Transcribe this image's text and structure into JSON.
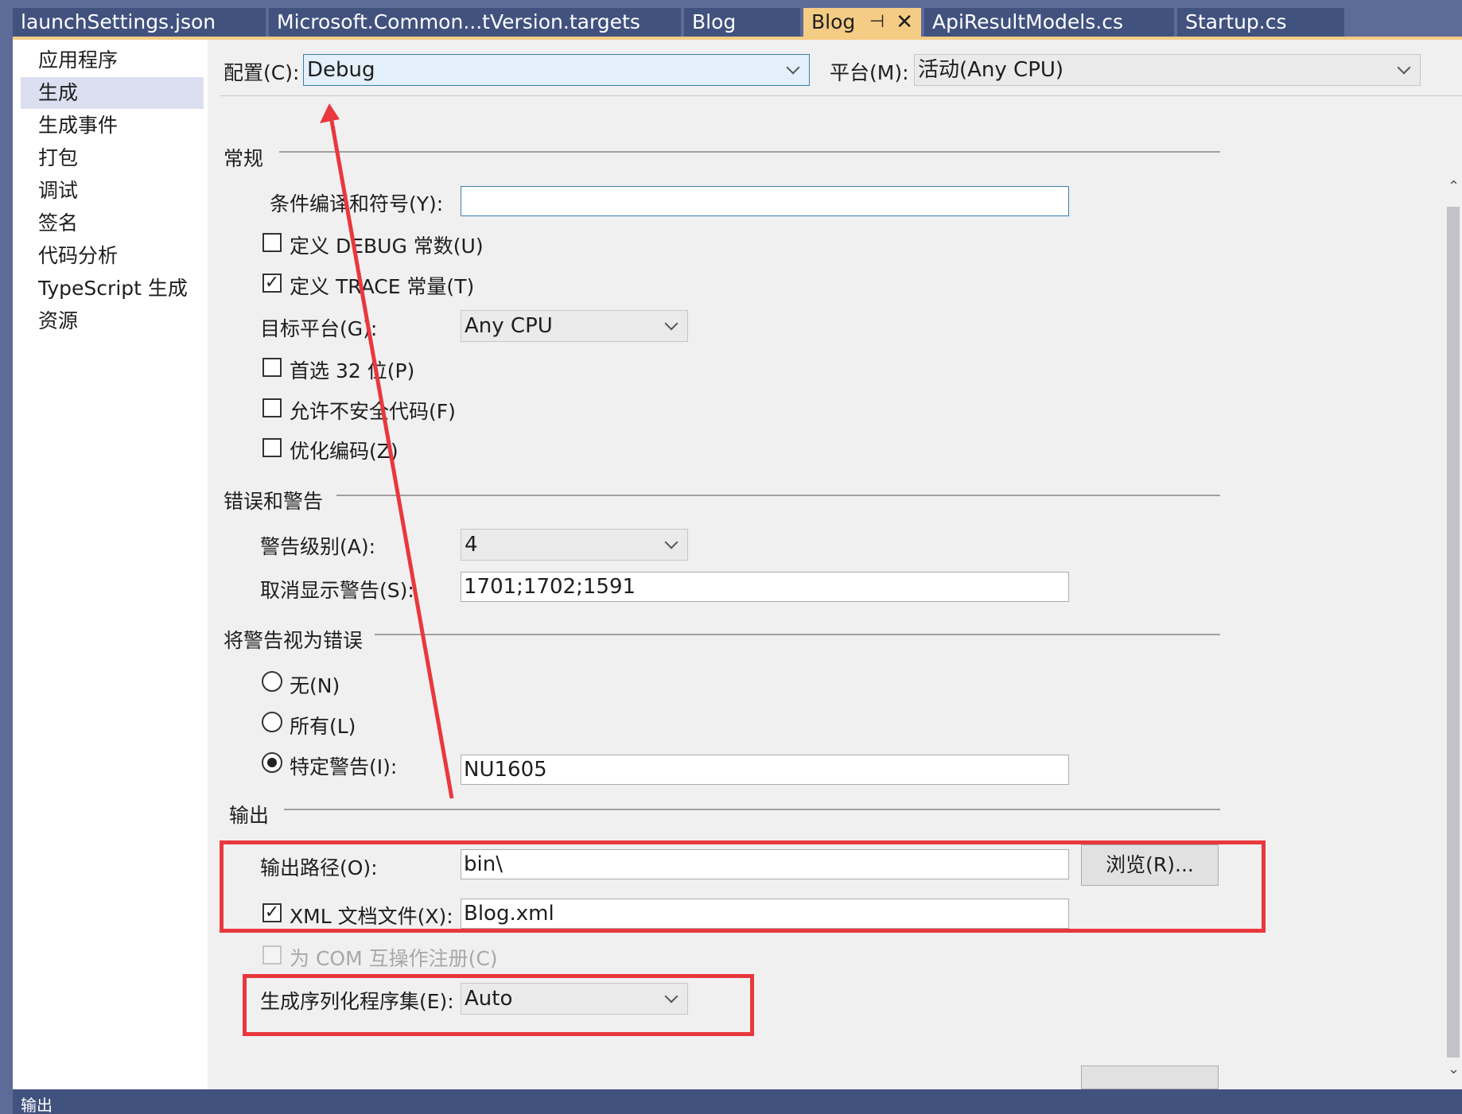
{
  "tabs": [
    {
      "label": "launchSettings.json"
    },
    {
      "label": "Microsoft.Common...tVersion.targets"
    },
    {
      "label": "Blog"
    },
    {
      "label": "Blog",
      "active": true,
      "pin_glyph": "⊣",
      "close_glyph": "✕"
    },
    {
      "label": "ApiResultModels.cs"
    },
    {
      "label": "Startup.cs"
    }
  ],
  "nav": {
    "items": [
      {
        "label": "应用程序"
      },
      {
        "label": "生成",
        "selected": true
      },
      {
        "label": "生成事件"
      },
      {
        "label": "打包"
      },
      {
        "label": "调试"
      },
      {
        "label": "签名"
      },
      {
        "label": "代码分析"
      },
      {
        "label": "TypeScript 生成"
      },
      {
        "label": "资源"
      }
    ]
  },
  "config": {
    "label": "配置(C):",
    "value": "Debug",
    "platform_label": "平台(M):",
    "platform_value": "活动(Any CPU)"
  },
  "general": {
    "title": "常规",
    "symbols_label": "条件编译和符号(Y):",
    "symbols_value": "",
    "define_debug": {
      "label": "定义 DEBUG 常数(U)",
      "checked": false
    },
    "define_trace": {
      "label": "定义 TRACE 常量(T)",
      "checked": true
    },
    "target_label": "目标平台(G):",
    "target_value": "Any CPU",
    "prefer32": {
      "label": "首选 32 位(P)",
      "checked": false
    },
    "unsafe": {
      "label": "允许不安全代码(F)",
      "checked": false
    },
    "optimize": {
      "label": "优化编码(Z)",
      "checked": false
    }
  },
  "errors": {
    "title": "错误和警告",
    "level_label": "警告级别(A):",
    "level_value": "4",
    "suppress_label": "取消显示警告(S):",
    "suppress_value": "1701;1702;1591"
  },
  "treat": {
    "title": "将警告视为错误",
    "none_label": "无(N)",
    "all_label": "所有(L)",
    "specific_label": "特定警告(I):",
    "specific_value": "NU1605",
    "selected": "specific"
  },
  "output": {
    "title": "输出",
    "path_label": "输出路径(O):",
    "path_value": "bin\\",
    "browse_label": "浏览(R)...",
    "xml_label": "XML 文档文件(X):",
    "xml_checked": true,
    "xml_value": "Blog.xml",
    "com_label": "为 COM 互操作注册(C)",
    "com_checked": false,
    "serial_label": "生成序列化程序集(E):",
    "serial_value": "Auto"
  },
  "glyphs": {
    "check": "✓",
    "scroll_up": "⌃",
    "scroll_down": "⌄"
  },
  "bottom": {
    "label": "输出"
  },
  "colors": {
    "annotation_red": "#e8383d",
    "tab_active": "#f5cc84",
    "tab_inactive": "#42527f",
    "frame": "#5d6b99"
  }
}
